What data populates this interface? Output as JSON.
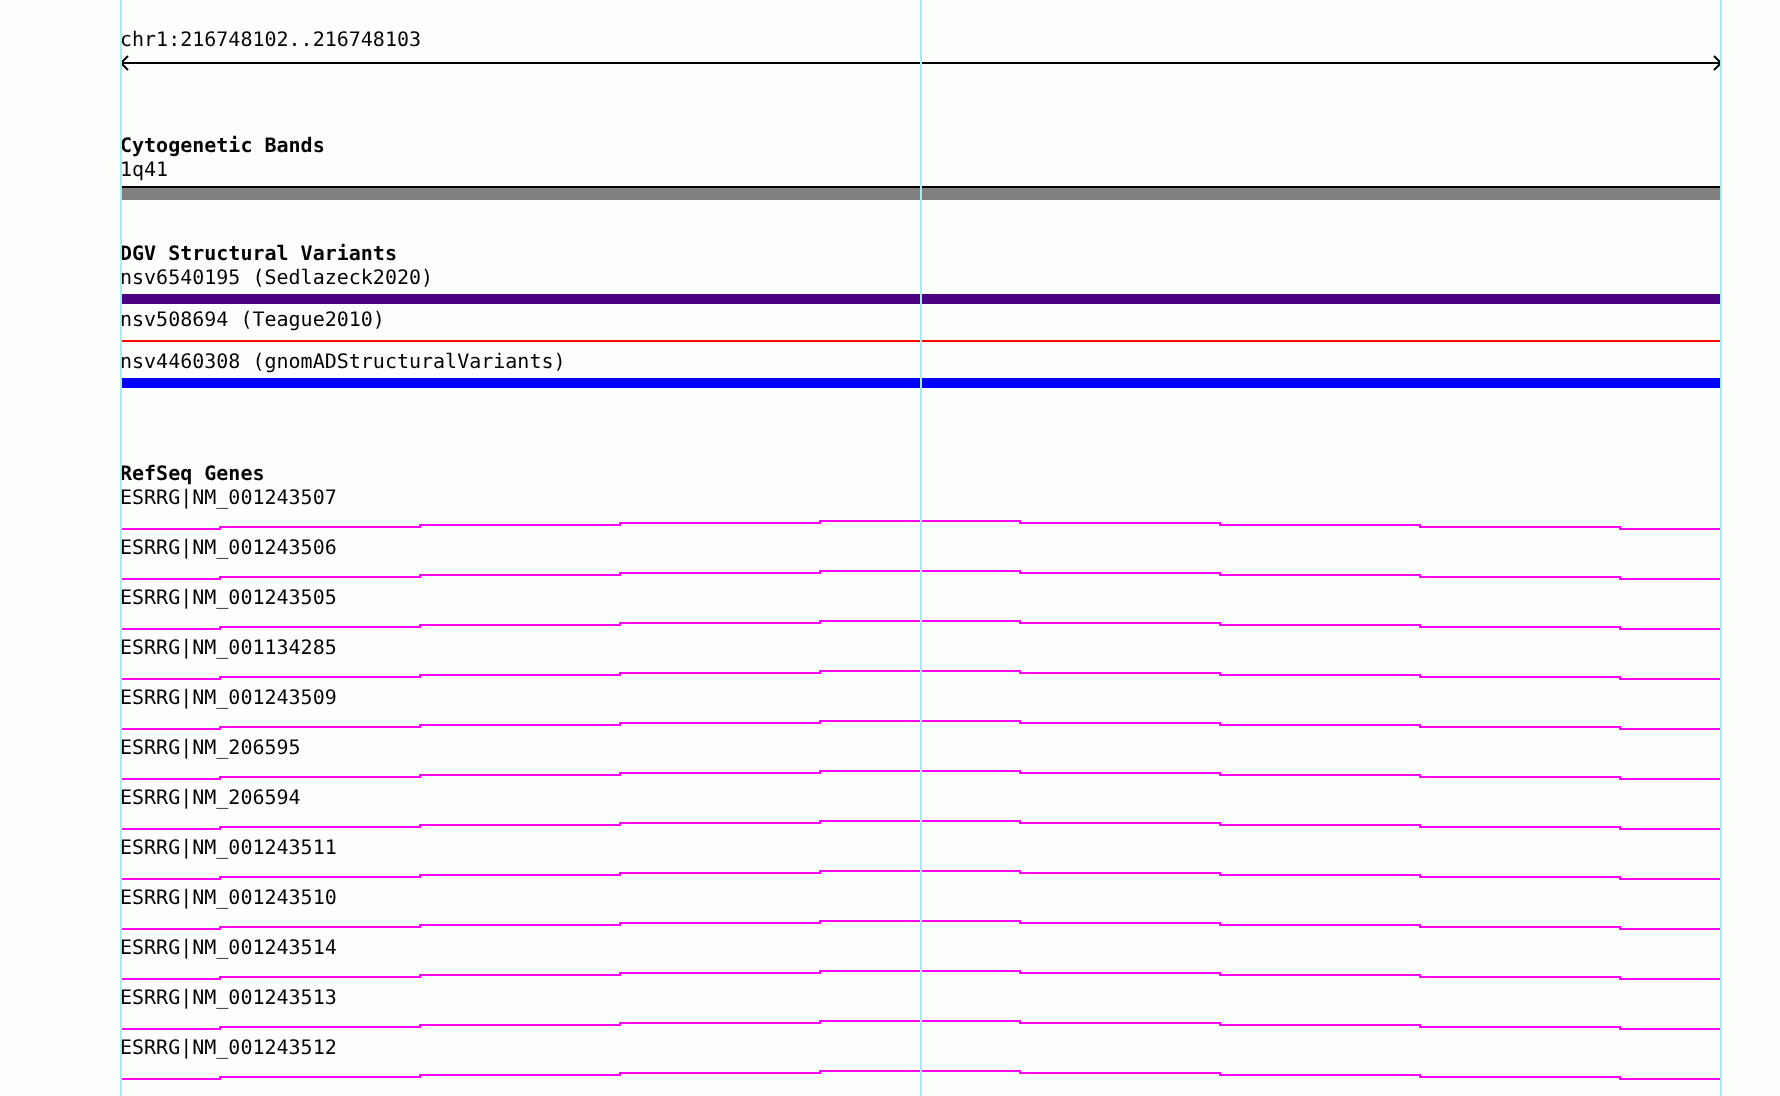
{
  "ruler": {
    "label": "chr1:216748102..216748103"
  },
  "cytogenetic_bands": {
    "title": "Cytogenetic Bands",
    "features": [
      {
        "label": "1q41"
      }
    ]
  },
  "dgv_structural_variants": {
    "title": "DGV Structural Variants",
    "features": [
      {
        "label": "nsv6540195 (Sedlazeck2020)",
        "kind": "bar",
        "color": "#4b0082"
      },
      {
        "label": "nsv508694 (Teague2010)",
        "kind": "line",
        "color": "#ff0000"
      },
      {
        "label": "nsv4460308 (gnomADStructuralVariants)",
        "kind": "bar",
        "color": "#0000ff"
      }
    ]
  },
  "refseq_genes": {
    "title": "RefSeq Genes",
    "features": [
      {
        "label": "ESRRG|NM_001243507"
      },
      {
        "label": "ESRRG|NM_001243506"
      },
      {
        "label": "ESRRG|NM_001243505"
      },
      {
        "label": "ESRRG|NM_001134285"
      },
      {
        "label": "ESRRG|NM_001243509"
      },
      {
        "label": "ESRRG|NM_206595"
      },
      {
        "label": "ESRRG|NM_206594"
      },
      {
        "label": "ESRRG|NM_001243511"
      },
      {
        "label": "ESRRG|NM_001243510"
      },
      {
        "label": "ESRRG|NM_001243514"
      },
      {
        "label": "ESRRG|NM_001243513"
      },
      {
        "label": "ESRRG|NM_001243512"
      }
    ]
  }
}
